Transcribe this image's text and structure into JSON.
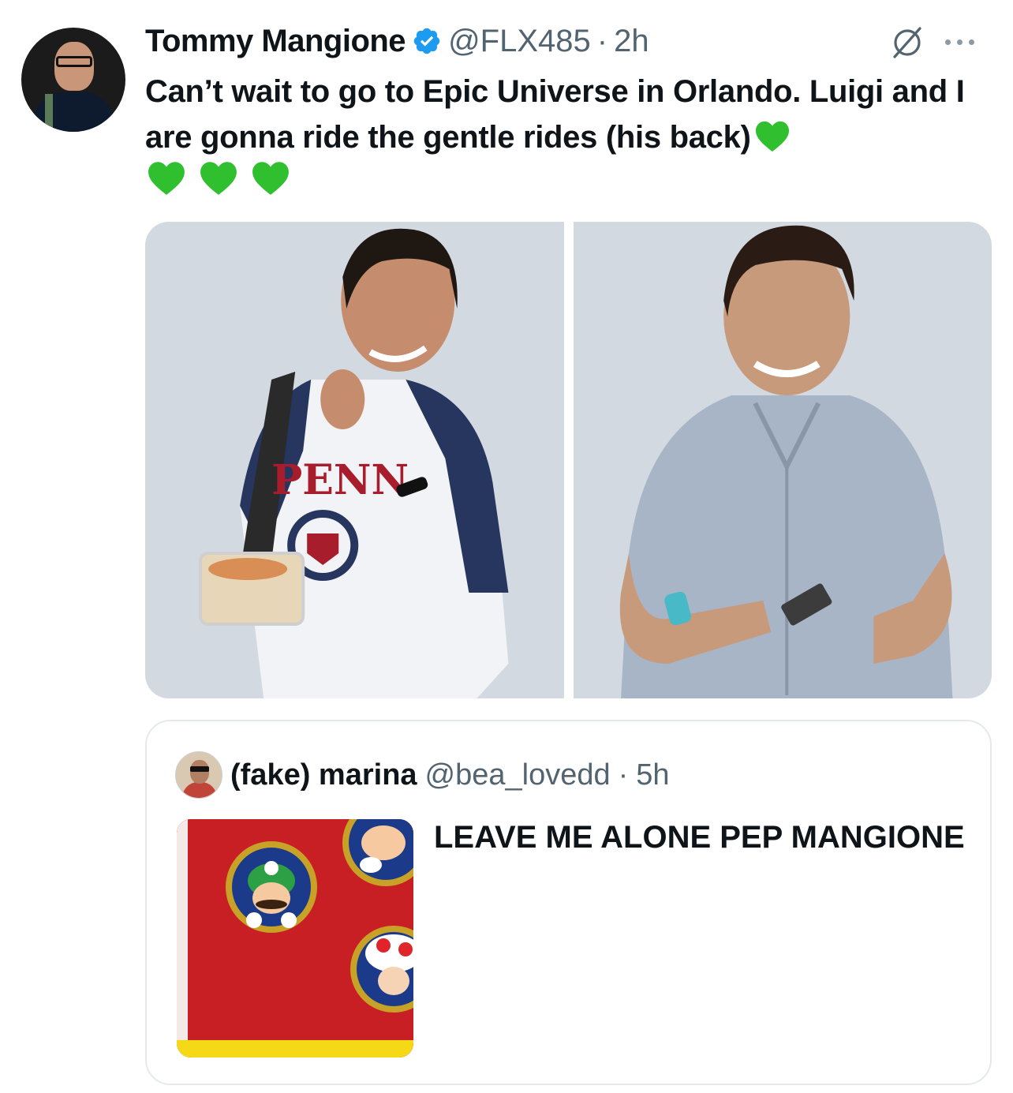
{
  "post": {
    "author": {
      "display_name": "Tommy Mangione",
      "handle": "@FLX485",
      "verified": true,
      "avatar_icon": "profile-photo-icon"
    },
    "separator": "·",
    "time": "2h",
    "text": "Can’t wait to go to Epic Universe in Orlando. Luigi and I are gonna ride the gentle rides (his back)",
    "emoji": [
      "green-heart",
      "green-heart",
      "green-heart",
      "green-heart"
    ],
    "actions": {
      "grok_icon": "grok-icon",
      "more_icon": "more-icon"
    },
    "media": [
      {
        "name": "photo-man-penn-shirt",
        "background": "#d2d9e0"
      },
      {
        "name": "photo-man-grey-shirt",
        "background": "#d2d9e0"
      }
    ]
  },
  "quote": {
    "author": {
      "display_name": "(fake) marina",
      "handle": "@bea_lovedd"
    },
    "separator": "·",
    "time": "5h",
    "text": "LEAVE ME ALONE PEP MANGIONE",
    "thumbnail": "mario-characters-image"
  },
  "colors": {
    "text": "#0f1419",
    "secondary": "#536471",
    "verified": "#1d9bf0",
    "heart": "#2fbf2f",
    "border": "#e6e9ec"
  }
}
